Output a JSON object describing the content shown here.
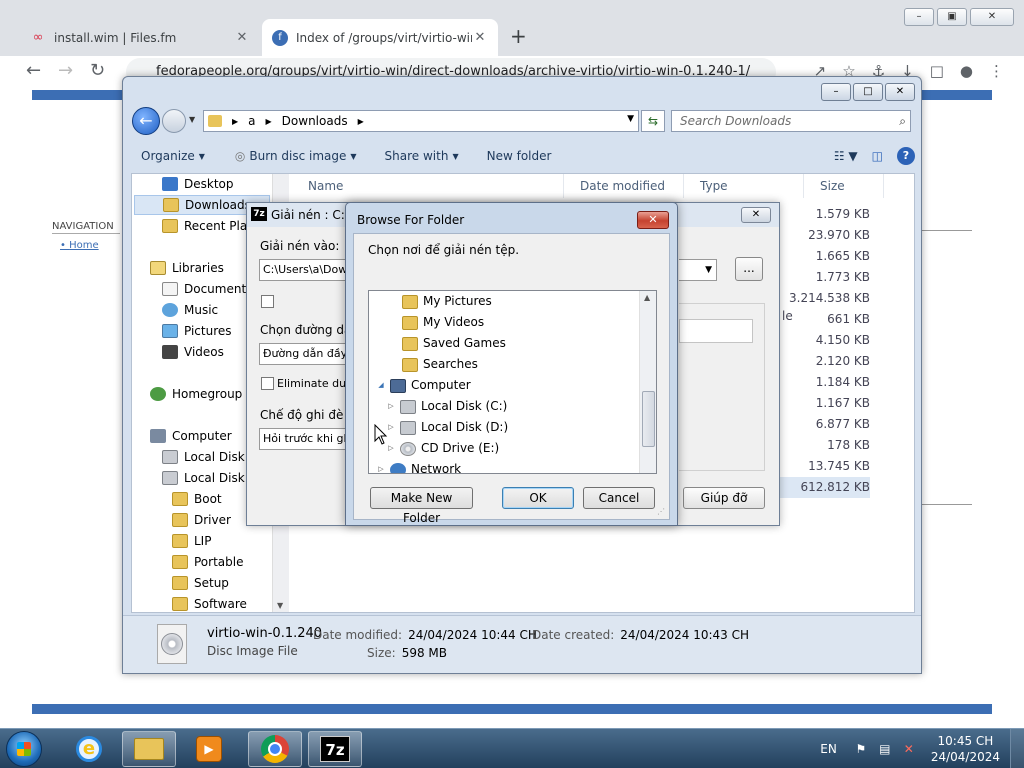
{
  "browser": {
    "tabs": [
      {
        "title": "install.wim | Files.fm",
        "active": false
      },
      {
        "title": "Index of /groups/virt/virtio-win/d",
        "active": true
      }
    ],
    "url": "fedorapeople.org/groups/virt/virtio-win/direct-downloads/archive-virtio/virtio-win-0.1.240-1/"
  },
  "webpage": {
    "nav_label": "NAVIGATION",
    "home_link": "Home"
  },
  "explorer": {
    "breadcrumb": [
      "a",
      "Downloads"
    ],
    "search_placeholder": "Search Downloads",
    "commands": {
      "organize": "Organize",
      "burn": "Burn disc image",
      "share": "Share with",
      "new_folder": "New folder"
    },
    "nav": {
      "favorites": [
        "Desktop",
        "Downloads",
        "Recent Place"
      ],
      "libraries": "Libraries",
      "library_items": [
        "Documents",
        "Music",
        "Pictures",
        "Videos"
      ],
      "homegroup": "Homegroup",
      "computer": "Computer",
      "drives": [
        "Local Disk (C",
        "Local Disk (D"
      ],
      "folders": [
        "Boot",
        "Driver",
        "LIP",
        "Portable",
        "Setup",
        "Software"
      ]
    },
    "columns": [
      "Name",
      "Date modified",
      "Type",
      "Size"
    ],
    "sizes": [
      "1.579 KB",
      "23.970 KB",
      "1.665 KB",
      "1.773 KB",
      "3.214.538 KB",
      "661 KB",
      "4.150 KB",
      "2.120 KB",
      "1.184 KB",
      "1.167 KB",
      "6.877 KB",
      "178 KB",
      "13.745 KB",
      "612.812 KB"
    ],
    "type_fragment": "le",
    "details": {
      "name": "virtio-win-0.1.240",
      "type": "Disc Image File",
      "date_modified_label": "Date modified:",
      "date_modified": "24/04/2024 10:44 CH",
      "date_created_label": "Date created:",
      "date_created": "24/04/2024 10:43 CH",
      "size_label": "Size:",
      "size": "598 MB"
    }
  },
  "sevenzip": {
    "logo": "7z",
    "title": "Giải nén : C:\\U",
    "extract_to_label": "Giải nén vào:",
    "extract_to_value": "C:\\Users\\a\\Down",
    "path_mode_label": "Chọn đường dẫn",
    "path_mode_value": "Đường dẫn đầy đ",
    "eliminate_label": "Eliminate duplic",
    "overwrite_label": "Chế độ ghi đè",
    "overwrite_value": "Hỏi trước khi ghi đ",
    "browse_button": "...",
    "help_button": "Giúp đỡ"
  },
  "browse_folder": {
    "title": "Browse For Folder",
    "instruction": "Chọn nơi để giải nén tệp.",
    "tree": [
      {
        "label": "My Pictures",
        "level": 2,
        "icon": "folder-icon"
      },
      {
        "label": "My Videos",
        "level": 2,
        "icon": "folder-icon"
      },
      {
        "label": "Saved Games",
        "level": 2,
        "icon": "folder-icon"
      },
      {
        "label": "Searches",
        "level": 2,
        "icon": "folder-icon"
      },
      {
        "label": "Computer",
        "level": 1,
        "icon": "computer-icon"
      },
      {
        "label": "Local Disk (C:)",
        "level": 2,
        "icon": "disk-icon"
      },
      {
        "label": "Local Disk (D:)",
        "level": 2,
        "icon": "disk-icon"
      },
      {
        "label": "CD Drive (E:)",
        "level": 2,
        "icon": "cd-icon"
      },
      {
        "label": "Network",
        "level": 1,
        "icon": "network-icon"
      }
    ],
    "make_new_folder": "Make New Folder",
    "ok": "OK",
    "cancel": "Cancel"
  },
  "taskbar": {
    "lang": "EN",
    "time": "10:45 CH",
    "date": "24/04/2024",
    "sevenzip_label": "7z"
  }
}
